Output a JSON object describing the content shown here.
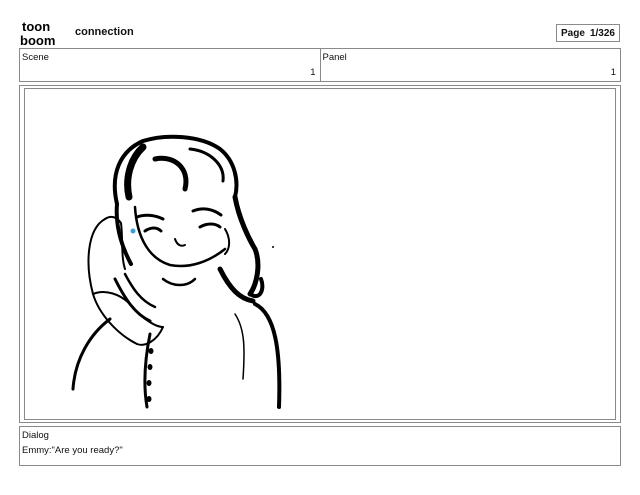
{
  "header": {
    "logo_line1": "toon",
    "logo_line2": "boom",
    "project_title": "connection",
    "page_label": "Page",
    "page_value": "1/326"
  },
  "scene": {
    "label": "Scene",
    "value": "1"
  },
  "panel": {
    "label": "Panel",
    "value": "1"
  },
  "dialog": {
    "label": "Dialog",
    "text": "Emmy:\"Are you ready?\""
  },
  "colors": {
    "border": "#8a8a8a",
    "ink": "#000000",
    "accent": "#3aa0d8"
  }
}
